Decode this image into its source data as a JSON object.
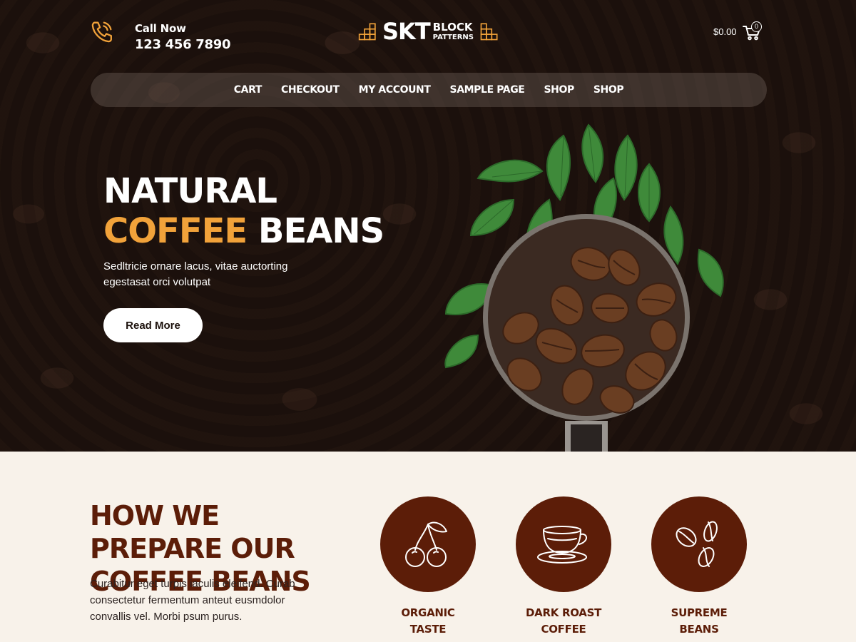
{
  "header": {
    "call_label": "Call Now",
    "phone": "123 456 7890",
    "logo_main": "SKT",
    "logo_sub_top": "BLOCK",
    "logo_sub_bottom": "PATTERNS",
    "cart_total": "$0.00",
    "cart_count": "0"
  },
  "nav": {
    "items": [
      {
        "label": "CART"
      },
      {
        "label": "CHECKOUT"
      },
      {
        "label": "MY ACCOUNT"
      },
      {
        "label": "SAMPLE PAGE"
      },
      {
        "label": "SHOP"
      },
      {
        "label": "SHOP"
      }
    ]
  },
  "hero": {
    "title_line1": "NATURAL",
    "title_accent": "COFFEE",
    "title_rest": "BEANS",
    "description": "Sedltricie ornare lacus, vitae auctorting egestasat orci volutpat",
    "button_label": "Read More",
    "image_icon": "coffee-scoop-image"
  },
  "prepare": {
    "title": "HOW WE PREPARE OUR COFFEE BEANS",
    "description": "Curabitur eget turpis iaculis eleifend. Curab consectetur fermentum anteut eusmdolor convallis vel. Morbi psum purus."
  },
  "features": [
    {
      "line1": "ORGANIC",
      "line2": "TASTE",
      "icon": "cherry-icon"
    },
    {
      "line1": "DARK ROAST",
      "line2": "COFFEE",
      "icon": "coffee-cup-icon"
    },
    {
      "line1": "SUPREME",
      "line2": "BEANS",
      "icon": "coffee-beans-icon"
    }
  ],
  "colors": {
    "accent": "#f1a23a",
    "brown": "#5c1d08",
    "hero_bg": "#1c110c",
    "section_bg": "#f8f2ea"
  }
}
